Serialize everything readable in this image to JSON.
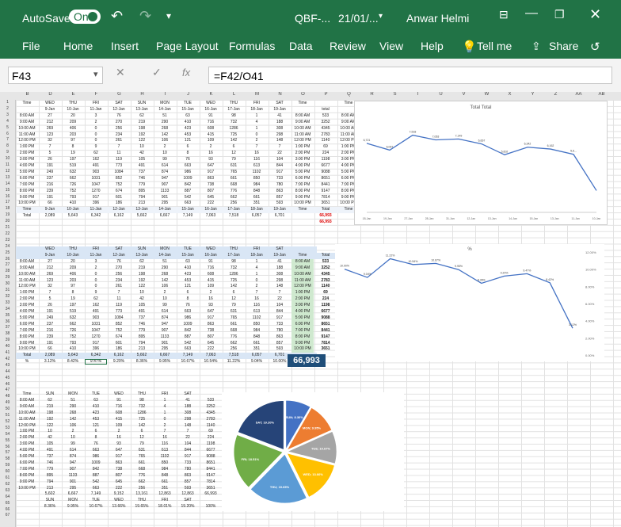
{
  "title_bar": {
    "autosave_label": "AutoSave",
    "autosave_state": "On",
    "file_name": "QBF-...",
    "date": "21/01/...",
    "user": "Anwar Helmi",
    "undo_icon": "undo-icon",
    "redo_icon": "redo-icon",
    "save_icon": "save-icon",
    "minimize_icon": "minimize-icon",
    "restore_icon": "restore-icon",
    "close_icon": "close-icon"
  },
  "menu": {
    "items": [
      "File",
      "Home",
      "Insert",
      "Page Layout",
      "Formulas",
      "Data",
      "Review",
      "View",
      "Help"
    ],
    "tell_me": "Tell me",
    "share": "Share"
  },
  "formula_bar": {
    "name_box": "F43",
    "formula": "=F42/O41"
  },
  "columns": [
    "B",
    "D",
    "E",
    "F",
    "G",
    "H",
    "I",
    "J",
    "K",
    "L",
    "M",
    "N",
    "O",
    "P",
    "Q",
    "R",
    "S",
    "T",
    "U",
    "V",
    "W",
    "X",
    "Y",
    "Z",
    "AA",
    "AB"
  ],
  "rows": [
    "1",
    "2",
    "3",
    "4",
    "5",
    "6",
    "7",
    "8",
    "9",
    "10",
    "11",
    "12",
    "13",
    "14",
    "15",
    "16",
    "17",
    "18",
    "19",
    "20",
    "21",
    "22",
    "23",
    "24",
    "25",
    "26",
    "27",
    "28",
    "29",
    "30",
    "31",
    "32",
    "33",
    "34",
    "35",
    "36",
    "37",
    "38",
    "39",
    "40",
    "41",
    "42",
    "43",
    "44",
    "45",
    "46",
    "47",
    "48",
    "49",
    "50",
    "51",
    "52",
    "53",
    "54",
    "55",
    "56",
    "57",
    "58",
    "59",
    "60",
    "61",
    "62",
    "63",
    "64",
    "65",
    "66",
    "67"
  ],
  "table1": {
    "header_days": [
      "WED",
      "THU",
      "FRI",
      "SAT",
      "SUN",
      "MON",
      "TUE",
      "WED",
      "THU",
      "FRI",
      "SAT",
      "Time",
      "",
      "Time"
    ],
    "header_dates": [
      "9-Jan",
      "10-Jan",
      "11-Jan",
      "12-Jan",
      "13-Jan",
      "14-Jan",
      "15-Jan",
      "16-Jan",
      "17-Jan",
      "18-Jan",
      "19-Jan",
      "",
      "total",
      ""
    ],
    "times": [
      "8:00 AM",
      "9:00 AM",
      "10:00 AM",
      "11:00 AM",
      "12:00 PM",
      "1:00 PM",
      "2:00 PM",
      "3:00 PM",
      "4:00 PM",
      "5:00 PM",
      "6:00 PM",
      "7:00 PM",
      "8:00 PM",
      "9:00 PM",
      "10:00 PM"
    ],
    "values": [
      [
        "27",
        "20",
        "3",
        "76",
        "62",
        "51",
        "63",
        "91",
        "98",
        "1",
        "41"
      ],
      [
        "212",
        "209",
        "2",
        "270",
        "219",
        "290",
        "410",
        "716",
        "732",
        "4",
        "188"
      ],
      [
        "269",
        "406",
        "0",
        "256",
        "198",
        "268",
        "423",
        "608",
        "1286",
        "1",
        "308"
      ],
      [
        "123",
        "203",
        "0",
        "234",
        "192",
        "142",
        "453",
        "415",
        "725",
        "0",
        "298"
      ],
      [
        "32",
        "97",
        "0",
        "261",
        "122",
        "106",
        "121",
        "109",
        "142",
        "2",
        "148"
      ],
      [
        "7",
        "8",
        "9",
        "7",
        "10",
        "2",
        "6",
        "2",
        "6",
        "7",
        "7"
      ],
      [
        "5",
        "19",
        "62",
        "11",
        "42",
        "10",
        "8",
        "16",
        "12",
        "16",
        "22"
      ],
      [
        "26",
        "197",
        "162",
        "119",
        "105",
        "99",
        "76",
        "93",
        "79",
        "116",
        "104"
      ],
      [
        "191",
        "519",
        "491",
        "773",
        "491",
        "614",
        "663",
        "647",
        "631",
        "613",
        "844"
      ],
      [
        "249",
        "632",
        "903",
        "1084",
        "737",
        "874",
        "986",
        "917",
        "765",
        "1102",
        "917"
      ],
      [
        "237",
        "662",
        "1031",
        "852",
        "746",
        "947",
        "1009",
        "863",
        "661",
        "850",
        "733"
      ],
      [
        "216",
        "726",
        "1047",
        "752",
        "779",
        "907",
        "842",
        "738",
        "668",
        "984",
        "780"
      ],
      [
        "239",
        "752",
        "1270",
        "674",
        "895",
        "1133",
        "887",
        "807",
        "776",
        "848",
        "863"
      ],
      [
        "191",
        "793",
        "917",
        "601",
        "794",
        "901",
        "542",
        "645",
        "662",
        "661",
        "857"
      ],
      [
        "66",
        "410",
        "396",
        "186",
        "213",
        "295",
        "663",
        "222",
        "256",
        "351",
        "593"
      ]
    ],
    "row_totals": [
      "533",
      "3252",
      "4345",
      "2783",
      "1140",
      "69",
      "224",
      "1198",
      "6677",
      "9088",
      "8651",
      "8441",
      "9147",
      "7814",
      "3651"
    ],
    "footer_days": [
      "9-Jan",
      "10-Jan",
      "11-Jan",
      "12-Jan",
      "13-Jan",
      "14-Jan",
      "15-Jan",
      "16-Jan",
      "17-Jan",
      "18-Jan",
      "19-Jan"
    ],
    "footer_totals": [
      "2,089",
      "5,643",
      "6,342",
      "6,162",
      "5,662",
      "6,667",
      "7,149",
      "7,063",
      "7,518",
      "6,057",
      "6,701"
    ],
    "grand_total_red": "66,993",
    "grand_total_red2": "66,993",
    "total_label": "Total",
    "time_label": "Time"
  },
  "table2": {
    "grand_total": "66,993",
    "pct_label": "%",
    "pcts": [
      "3.12%",
      "8.42%",
      "9.47%",
      "9.20%",
      "8.36%",
      "9.95%",
      "10.67%",
      "10.54%",
      "11.22%",
      "9.04%",
      "10.00%"
    ],
    "hundred": "100%",
    "total_label": "Total",
    "time_label": "Time"
  },
  "table3": {
    "header": [
      "Time",
      "SUN",
      "MON",
      "TUE",
      "WED",
      "THU",
      "FRI",
      "SAT"
    ],
    "footer_days": [
      "SUN",
      "MON",
      "TUE",
      "WED",
      "THU",
      "FRI",
      "SAT"
    ],
    "footer_totals": [
      "5,602",
      "6,667",
      "7,149",
      "9,152",
      "13,161",
      "12,863",
      "12,863",
      "66,993"
    ],
    "pcts": [
      "8.36%",
      "9.95%",
      "10.67%",
      "13.66%",
      "19.65%",
      "18.01%",
      "19.20%",
      "100%"
    ]
  },
  "chart1": {
    "title": "Total Total",
    "x": [
      "18-Jan",
      "19-Jan",
      "27-Jan",
      "28-Jan",
      "31-Jan",
      "12-Jan",
      "13-Jan",
      "14-Jan",
      "15-Jan",
      "13-Jan",
      "11-Jan",
      "10-Jan"
    ],
    "labels": [
      "6,721",
      "6,067",
      "7,518",
      "7,063",
      "7,149",
      "6,667",
      "5,602",
      "6,342",
      "6,162",
      "5,6..."
    ]
  },
  "chart2": {
    "title": "%",
    "y_ticks": [
      "12.00%",
      "10.00%",
      "8.00%",
      "6.00%",
      "4.00%",
      "2.00%",
      "0.00%"
    ],
    "labels": [
      "10.00%",
      "9.04%",
      "11.22%",
      "10.54%",
      "10.67%",
      "9.95%",
      "8.36%",
      "9.20%",
      "9.47%",
      "8.42%",
      "3.12%"
    ]
  },
  "chart_data": [
    {
      "type": "line",
      "title": "Total Total",
      "x": [
        "18-Jan",
        "19-Jan",
        "27-Jan",
        "28-Jan",
        "31-Jan",
        "12-Jan",
        "13-Jan",
        "14-Jan",
        "15-Jan",
        "13-Jan",
        "11-Jan",
        "10-Jan"
      ],
      "series": [
        {
          "values": [
            6721,
            6057,
            7518,
            7063,
            7149,
            6667,
            5602,
            6342,
            6162,
            5643,
            2089
          ]
        }
      ]
    },
    {
      "type": "line",
      "title": "%",
      "ylim": [
        0,
        12
      ],
      "series": [
        {
          "values": [
            10.0,
            9.04,
            11.22,
            10.54,
            10.67,
            9.95,
            8.36,
            9.2,
            9.47,
            8.42,
            3.12
          ]
        }
      ]
    },
    {
      "type": "pie",
      "categories": [
        "SUN",
        "MON",
        "TUE",
        "WED",
        "THU",
        "FRI",
        "SAT"
      ],
      "values": [
        8.36,
        9.95,
        10.67,
        13.66,
        19.65,
        18.51,
        19.2
      ],
      "labels": [
        "SUN; 8.36%",
        "MON; 9.95%",
        "TUE; 10.67%",
        "WED; 13.66%",
        "THU; 19.65%",
        "FRI; 18.51%",
        "SAT; 19.20%"
      ],
      "colors": [
        "#4472c4",
        "#ed7d31",
        "#a5a5a5",
        "#ffc000",
        "#5b9bd5",
        "#70ad47",
        "#264478"
      ]
    }
  ]
}
